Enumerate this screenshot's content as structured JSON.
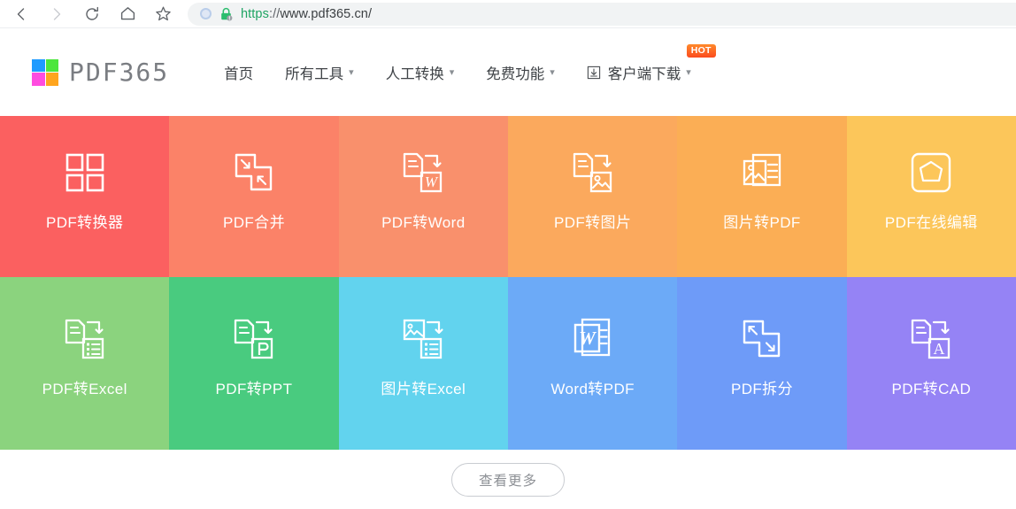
{
  "browser": {
    "back_icon": "chevron-left-icon",
    "forward_icon": "chevron-right-icon",
    "reload_icon": "reload-icon",
    "home_icon": "home-icon",
    "bookmark_icon": "star-icon",
    "security_icon": "lock-icon",
    "profile_icon": "circle-icon",
    "url_scheme": "https",
    "url_separator": "://",
    "url_host": "www.pdf365.cn/",
    "url_full": "https://www.pdf365.cn/"
  },
  "site": {
    "logo_text": "PDF365",
    "logo_colors": {
      "top_left": "#1e9bff",
      "top_right": "#4ce63c",
      "bottom_left": "#ff4ce0",
      "bottom_right": "#ffa51e"
    },
    "nav": [
      {
        "label": "首页",
        "has_chevron": false,
        "icon": null,
        "badge": null
      },
      {
        "label": "所有工具",
        "has_chevron": true,
        "icon": null,
        "badge": null
      },
      {
        "label": "人工转换",
        "has_chevron": true,
        "icon": null,
        "badge": null
      },
      {
        "label": "免费功能",
        "has_chevron": true,
        "icon": null,
        "badge": null
      },
      {
        "label": "客户端下载",
        "has_chevron": true,
        "icon": "download-icon",
        "badge": "HOT"
      }
    ]
  },
  "tiles": [
    {
      "label": "PDF转换器",
      "icon": "grid-four-icon",
      "color": "#fb6060"
    },
    {
      "label": "PDF合并",
      "icon": "merge-arrows-icon",
      "color": "#fb8268"
    },
    {
      "label": "PDF转Word",
      "icon": "doc-to-word-icon",
      "color": "#f9906c"
    },
    {
      "label": "PDF转图片",
      "icon": "doc-to-image-icon",
      "color": "#fba95d"
    },
    {
      "label": "图片转PDF",
      "icon": "image-to-doc-icon",
      "color": "#fbae55"
    },
    {
      "label": "PDF在线编辑",
      "icon": "edit-shape-icon",
      "color": "#fcc65a"
    },
    {
      "label": "PDF转Excel",
      "icon": "doc-to-excel-icon",
      "color": "#8bd37e"
    },
    {
      "label": "PDF转PPT",
      "icon": "doc-to-ppt-icon",
      "color": "#49cb7f"
    },
    {
      "label": "图片转Excel",
      "icon": "image-to-excel-icon",
      "color": "#62d3ee"
    },
    {
      "label": "Word转PDF",
      "icon": "word-doc-icon",
      "color": "#6caaf7"
    },
    {
      "label": "PDF拆分",
      "icon": "split-arrows-icon",
      "color": "#6e9bf8"
    },
    {
      "label": "PDF转CAD",
      "icon": "doc-to-cad-icon",
      "color": "#9583f5"
    }
  ],
  "more_button": {
    "label": "查看更多"
  }
}
